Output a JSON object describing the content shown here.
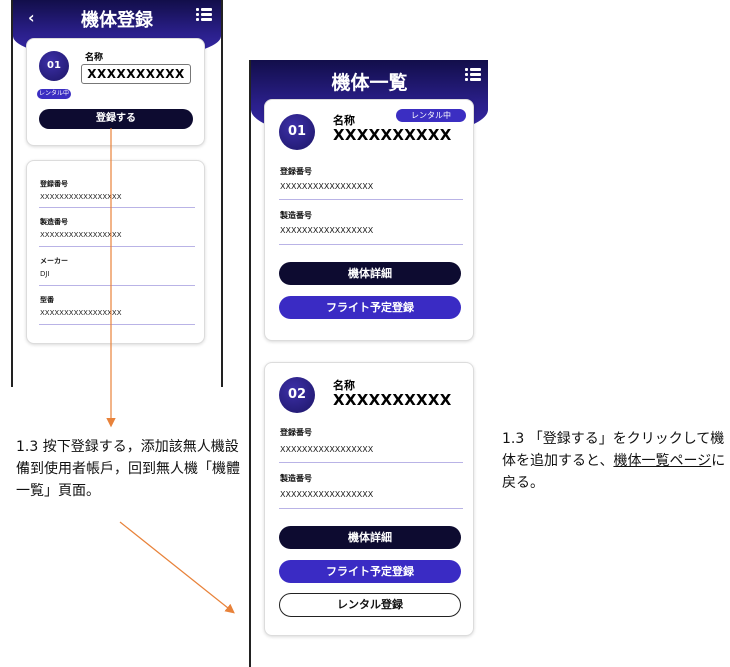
{
  "left_screen": {
    "title": "機体登録",
    "back_icon": "chevron-left-icon",
    "menu_icon": "list-menu-icon",
    "reg_card": {
      "number": "01",
      "name_label": "名称",
      "name_value": "XXXXXXXXXX",
      "badge": "レンタル中",
      "register_button": "登録する"
    },
    "details": [
      {
        "label": "登録番号",
        "value": "XXXXXXXXXXXXXXXXX"
      },
      {
        "label": "製造番号",
        "value": "XXXXXXXXXXXXXXXXX"
      },
      {
        "label": "メーカー",
        "value": "DJI"
      },
      {
        "label": "型番",
        "value": "XXXXXXXXXXXXXXXXX"
      }
    ]
  },
  "right_screen": {
    "title": "機体一覧",
    "menu_icon": "list-menu-icon",
    "cards": [
      {
        "number": "01",
        "name_label": "名称",
        "name_value": "XXXXXXXXXX",
        "badge": "レンタル中",
        "fields": [
          {
            "label": "登録番号",
            "value": "XXXXXXXXXXXXXXXXX"
          },
          {
            "label": "製造番号",
            "value": "XXXXXXXXXXXXXXXXX"
          }
        ],
        "detail_button": "機体詳細",
        "flight_button": "フライト予定登録"
      },
      {
        "number": "02",
        "name_label": "名称",
        "name_value": "XXXXXXXXXX",
        "fields": [
          {
            "label": "登録番号",
            "value": "XXXXXXXXXXXXXXXXX"
          },
          {
            "label": "製造番号",
            "value": "XXXXXXXXXXXXXXXXX"
          }
        ],
        "detail_button": "機体詳細",
        "flight_button": "フライト予定登録",
        "rental_button": "レンタル登録"
      }
    ]
  },
  "annotations": {
    "left_note": "1.3 按下登録する，添加該無人機設備到使用者帳戶，回到無人機「機體一覧」頁面。",
    "right_note_pre": "1.3 「登録する」をクリックして機体を追加すると、",
    "right_note_link": "機体一覧ページ",
    "right_note_post": "に戻る。"
  },
  "colors": {
    "header_dark": "#120e4a",
    "header_light": "#3a2bb0",
    "primary_purple": "#3a2bc4",
    "dark_button": "#0d0b30",
    "arrow": "#e8823a"
  }
}
